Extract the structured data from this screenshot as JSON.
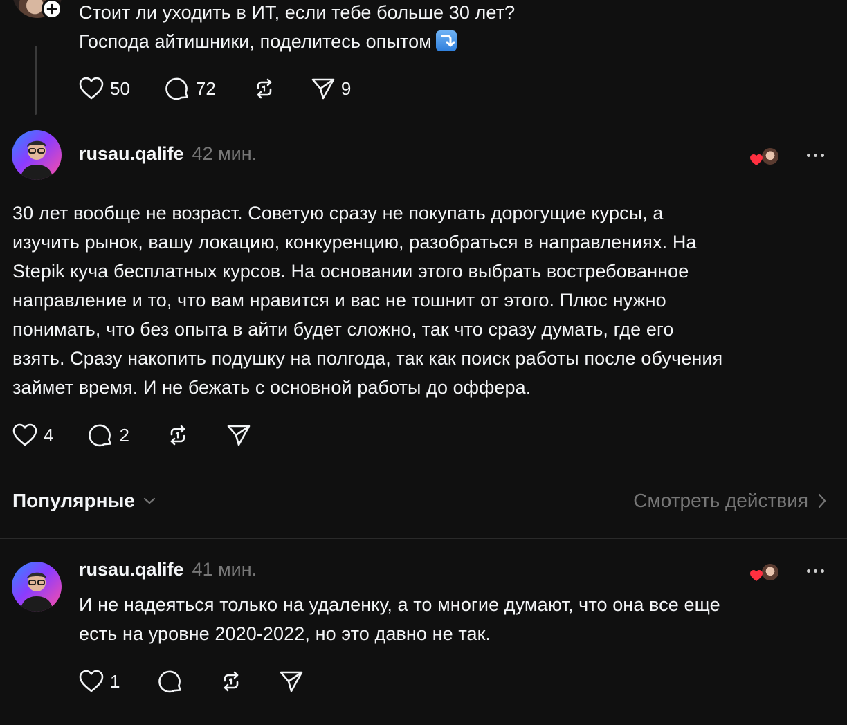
{
  "original_post": {
    "text_line1": "Стоит ли уходить в ИТ, если тебе больше 30 лет?",
    "text_line2": "Господа айтишники, поделитесь опытом",
    "likes": "50",
    "comments": "72",
    "shares": "9"
  },
  "reply1": {
    "username": "rusau.qalife",
    "time": "42 мин.",
    "lines": [
      "30 лет вообще не возраст. Советую сразу не покупать дорогущие курсы, а",
      "изучить рынок, вашу локацию, конкуренцию, разобраться в направлениях. На",
      "Stepik куча бесплатных курсов. На основании этого выбрать востребованное",
      "направление и то, что вам нравится и вас не тошнит от этого. Плюс нужно",
      "понимать, что без опыта в айти будет сложно, так что сразу думать, где его",
      "взять. Сразу накопить подушку на полгода, так как поиск работы после обучения",
      "займет время. И не бежать с основной работы до оффера."
    ],
    "likes": "4",
    "comments": "2"
  },
  "sort_bar": {
    "sort_label": "Популярные",
    "see_actions": "Смотреть действия"
  },
  "reply2": {
    "username": "rusau.qalife",
    "time": "41 мин.",
    "lines": [
      "И не надеяться только на удаленку, а то многие думают, что она все еще",
      "есть на уровне 2020-2022, но это давно не так."
    ],
    "likes": "1"
  },
  "colors": {
    "background": "#101010",
    "text": "#f3f5f7",
    "muted": "#777777",
    "heart_red": "#ff3040"
  }
}
